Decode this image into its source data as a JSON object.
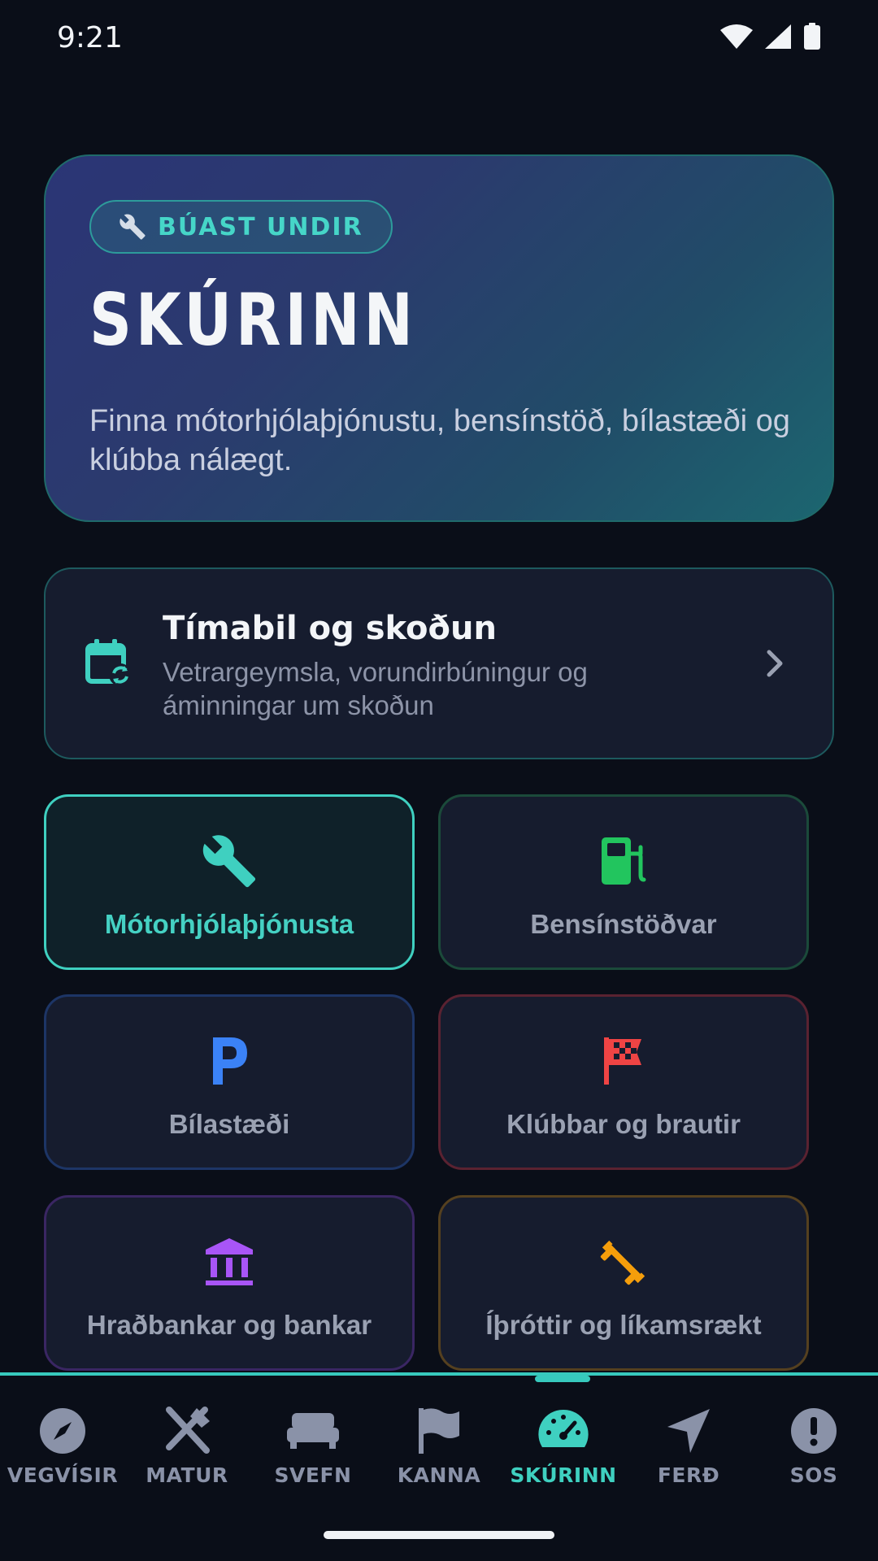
{
  "status": {
    "time": "9:21",
    "icons": [
      "wifi-icon",
      "signal-icon",
      "battery-icon"
    ]
  },
  "hero": {
    "badge": "BÚAST UNDIR",
    "badge_icon": "wrench-icon",
    "title": "SKÚRINN",
    "description": "Finna mótorhjólaþjónustu, bensínstöð, bílastæði og klúbba nálægt."
  },
  "season": {
    "title": "Tímabil og skoðun",
    "subtitle": "Vetrargeymsla, vorundirbúningur og áminningar um skoðun",
    "icon": "calendar-sync-icon"
  },
  "tiles": [
    {
      "label": "Mótorhjólaþjónusta",
      "icon": "wrench-icon",
      "color": "#3fd0c0",
      "active": true
    },
    {
      "label": "Bensínstöðvar",
      "icon": "fuel-pump-icon",
      "color": "#22c55e"
    },
    {
      "label": "Bílastæði",
      "icon": "parking-icon",
      "color": "#3b82f6"
    },
    {
      "label": "Klúbbar og brautir",
      "icon": "checkered-flag-icon",
      "color": "#ef4444"
    },
    {
      "label": "Hraðbankar og bankar",
      "icon": "bank-icon",
      "color": "#a855f7"
    },
    {
      "label": "Íþróttir og líkamsrækt",
      "icon": "dumbbell-icon",
      "color": "#f59e0b"
    }
  ],
  "nav": [
    {
      "label": "VEGVÍSIR",
      "icon": "compass-icon"
    },
    {
      "label": "MATUR",
      "icon": "utensils-icon"
    },
    {
      "label": "SVEFN",
      "icon": "bed-icon"
    },
    {
      "label": "KANNA",
      "icon": "flag-icon"
    },
    {
      "label": "SKÚRINN",
      "icon": "speedometer-icon",
      "active": true
    },
    {
      "label": "FERÐ",
      "icon": "navigation-icon"
    },
    {
      "label": "SOS",
      "icon": "alert-icon"
    }
  ],
  "colors": {
    "accent": "#3fd0c0",
    "background": "#0a0e18",
    "card": "#161c2e"
  }
}
